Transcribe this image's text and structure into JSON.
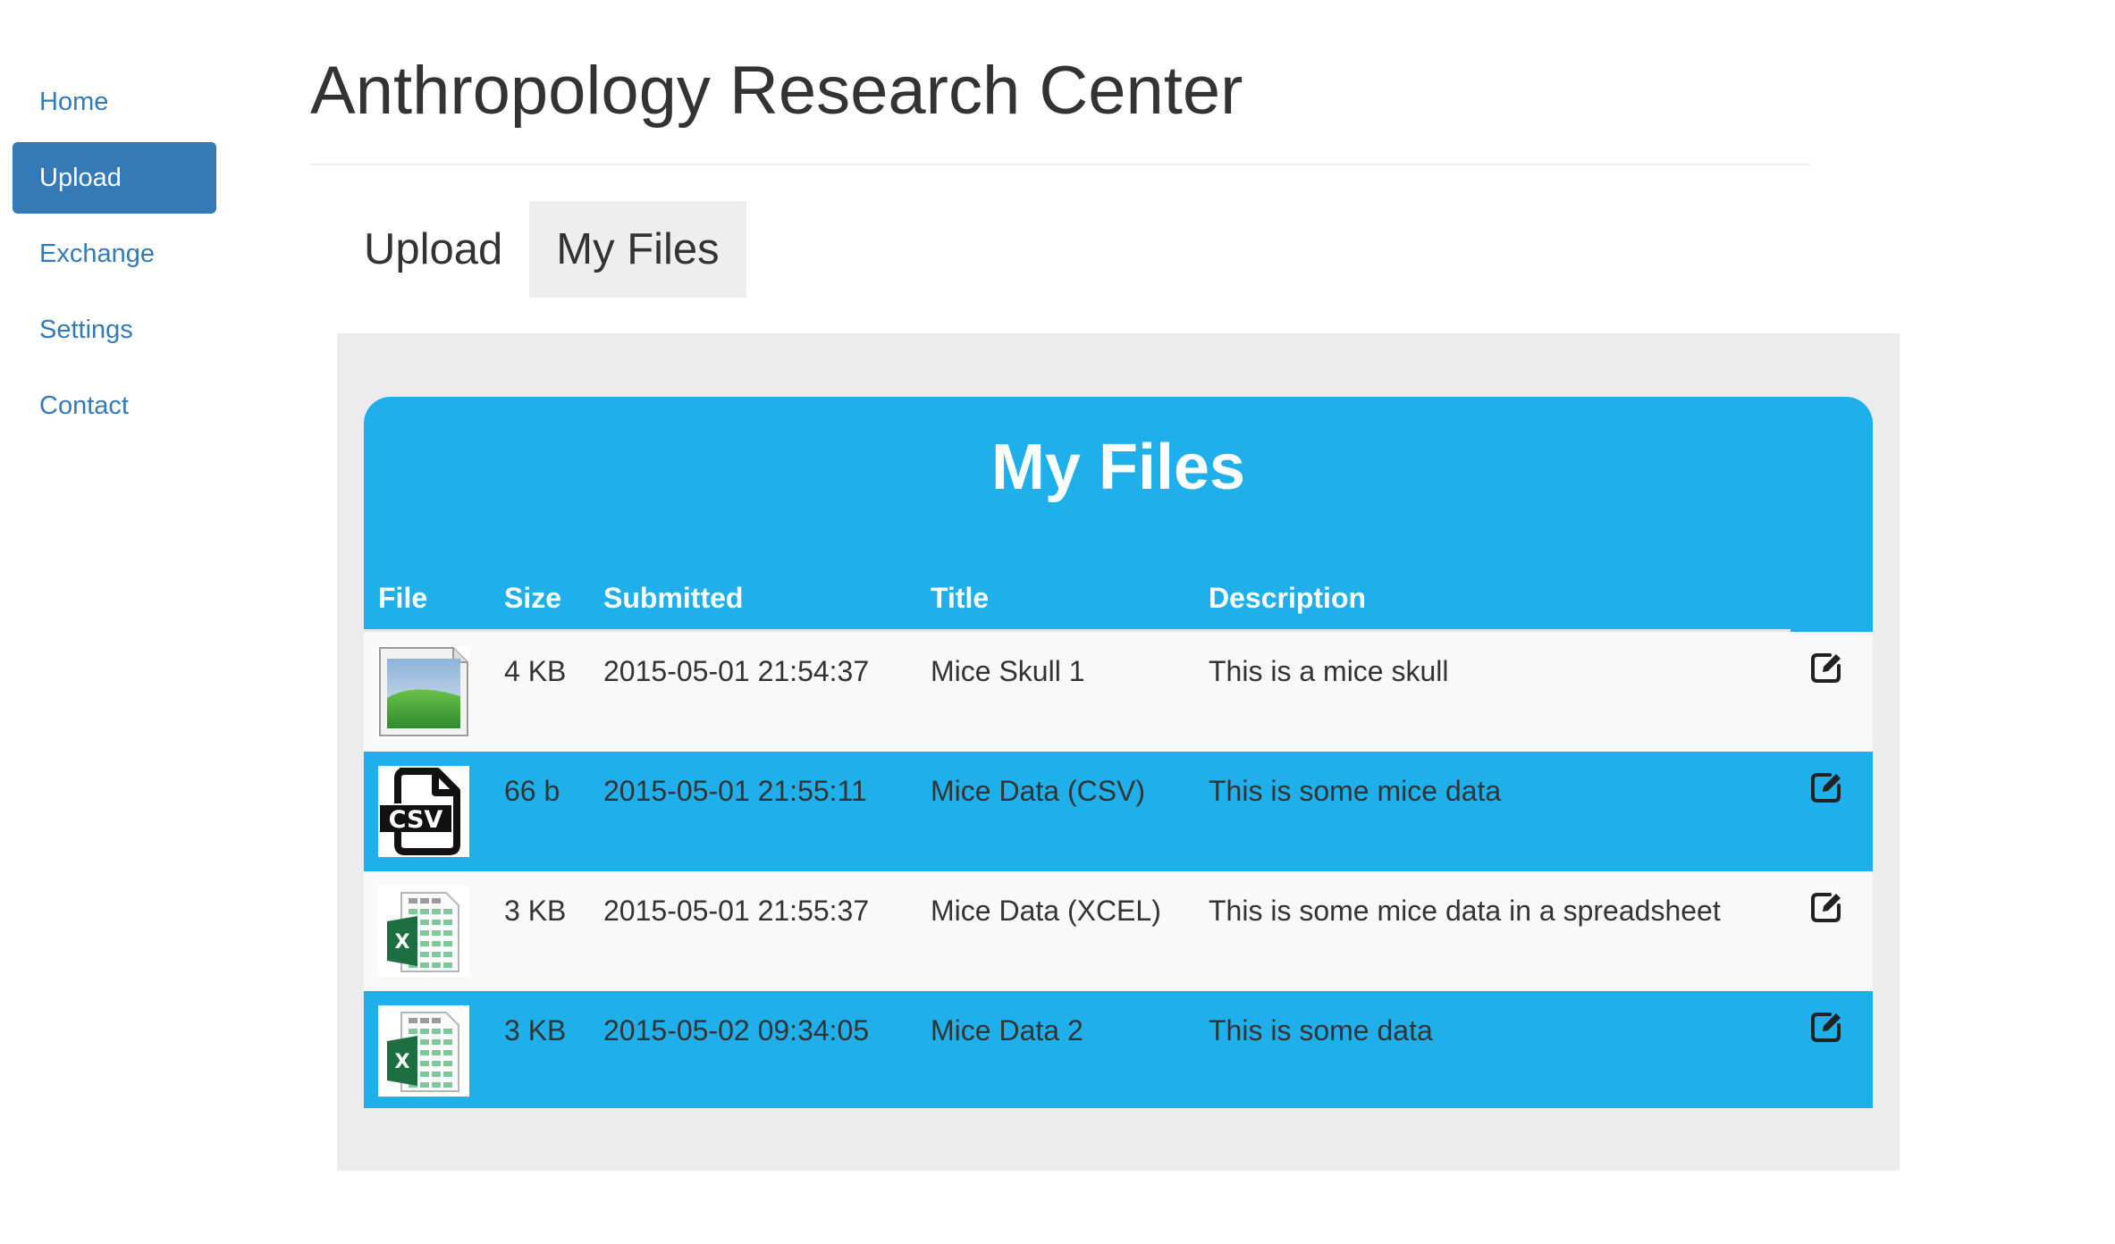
{
  "sidebar": {
    "items": [
      {
        "label": "Home"
      },
      {
        "label": "Upload"
      },
      {
        "label": "Exchange"
      },
      {
        "label": "Settings"
      },
      {
        "label": "Contact"
      }
    ],
    "active": "Upload"
  },
  "header": {
    "title": "Anthropology Research Center"
  },
  "tabs": [
    {
      "label": "Upload"
    },
    {
      "label": "My Files"
    }
  ],
  "active_tab": "My Files",
  "files_panel": {
    "title": "My Files",
    "columns": {
      "file": "File",
      "size": "Size",
      "submitted": "Submitted",
      "title": "Title",
      "description": "Description"
    },
    "rows": [
      {
        "icon": "image-file-icon",
        "size": "4 KB",
        "submitted": "2015-05-01 21:54:37",
        "title": "Mice Skull 1",
        "description": "This is a mice skull"
      },
      {
        "icon": "csv-file-icon",
        "icon_text": "CSV",
        "size": "66 b",
        "submitted": "2015-05-01 21:55:11",
        "title": "Mice Data (CSV)",
        "description": "This is some mice data"
      },
      {
        "icon": "excel-file-icon",
        "icon_text": "X",
        "size": "3 KB",
        "submitted": "2015-05-01 21:55:37",
        "title": "Mice Data (XCEL)",
        "description": "This is some mice data in a spreadsheet"
      },
      {
        "icon": "excel-file-icon",
        "icon_text": "X",
        "size": "3 KB",
        "submitted": "2015-05-02 09:34:05",
        "title": "Mice Data 2",
        "description": "This is some data"
      }
    ]
  },
  "colors": {
    "accent": "#1fb0eb",
    "nav_link": "#337ab7",
    "nav_active_bg": "#337ab7",
    "panel_bg": "#ececec",
    "tab_active_bg": "#eeeeee",
    "row_light": "#f9f9f9",
    "excel_green": "#1d6f42"
  }
}
